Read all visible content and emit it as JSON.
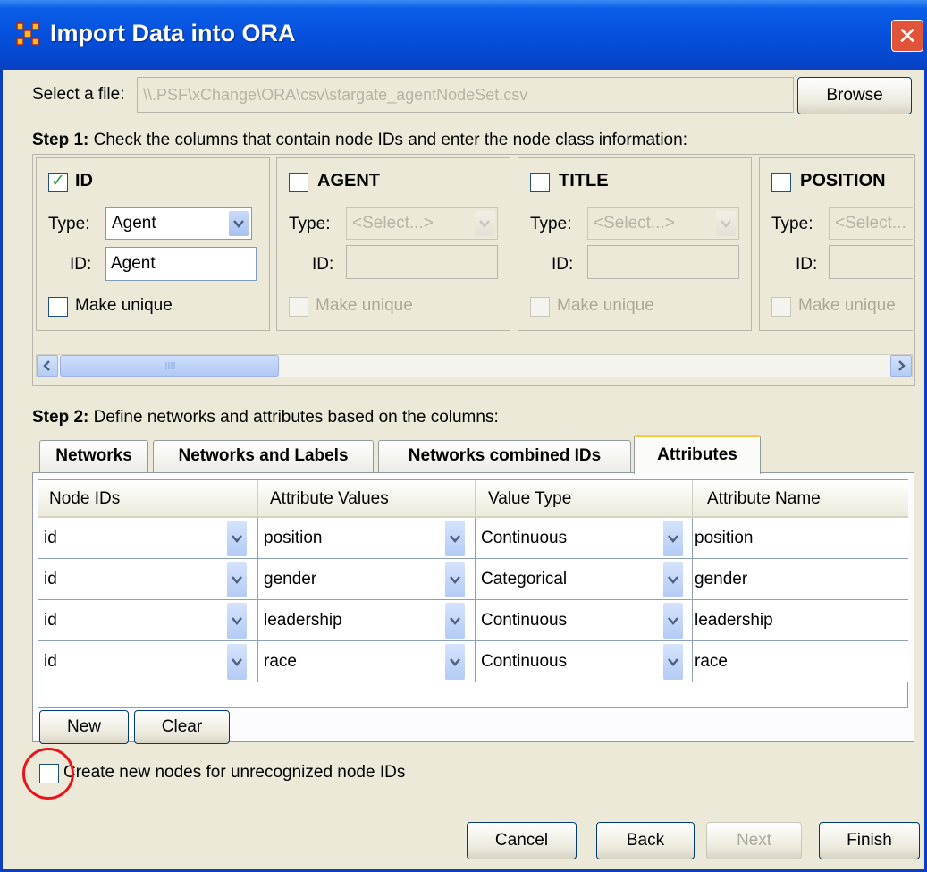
{
  "window": {
    "title": "Import Data into ORA",
    "close_symbol": "✕"
  },
  "file": {
    "label": "Select a file:",
    "path": "\\\\.PSF\\xChange\\ORA\\csv\\stargate_agentNodeSet.csv",
    "browse_label": "Browse"
  },
  "step1": {
    "heading_bold": "Step 1:",
    "heading_text": " Check the columns that contain node IDs and enter the node class information:",
    "type_label": "Type:",
    "id_label": "ID:",
    "unique_label": "Make unique",
    "columns": [
      {
        "name": "ID",
        "checked": true,
        "type": "Agent",
        "id": "Agent",
        "enabled": true
      },
      {
        "name": "AGENT",
        "checked": false,
        "type": "<Select...>",
        "id": "",
        "enabled": false
      },
      {
        "name": "TITLE",
        "checked": false,
        "type": "<Select...>",
        "id": "",
        "enabled": false
      },
      {
        "name": "POSITION",
        "checked": false,
        "type": "<Select...",
        "id": "",
        "enabled": false
      }
    ]
  },
  "step2": {
    "heading_bold": "Step 2:",
    "heading_text": " Define networks and attributes based on the columns:",
    "tabs": [
      "Networks",
      "Networks and Labels",
      "Networks combined IDs",
      "Attributes"
    ],
    "active_tab": "Attributes",
    "table": {
      "headers": [
        "Node IDs",
        "Attribute Values",
        "Value Type",
        "Attribute Name"
      ],
      "rows": [
        [
          "id",
          "position",
          "Continuous",
          "position"
        ],
        [
          "id",
          "gender",
          "Categorical",
          "gender"
        ],
        [
          "id",
          "leadership",
          "Continuous",
          "leadership"
        ],
        [
          "id",
          "race",
          "Continuous",
          "race"
        ]
      ]
    },
    "new_label": "New",
    "clear_label": "Clear"
  },
  "create_nodes": {
    "label": "Create new nodes for unrecognized node IDs",
    "checked": false
  },
  "buttons": {
    "cancel": "Cancel",
    "back": "Back",
    "next": "Next",
    "finish": "Finish"
  },
  "colors": {
    "titlebar": "#0550dc",
    "highlight_circle": "#e8161c",
    "active_tab_accent": "#ffc83c"
  }
}
